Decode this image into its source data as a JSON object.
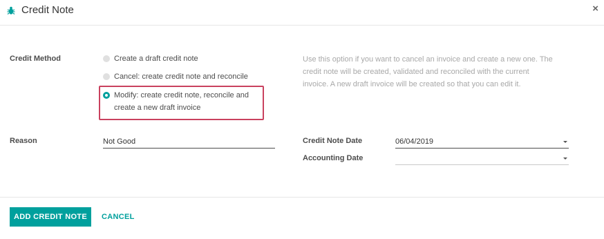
{
  "dialog": {
    "title": "Credit Note",
    "close_glyph": "×"
  },
  "credit_method": {
    "label": "Credit Method",
    "options": [
      {
        "lines": [
          "Create a draft credit note"
        ],
        "selected": false
      },
      {
        "lines": [
          "Cancel: create credit note and reconcile"
        ],
        "selected": false
      },
      {
        "lines": [
          "Modify: create credit note, reconcile and",
          "create a new draft invoice"
        ],
        "selected": true
      }
    ],
    "help_lines": [
      "Use this option if you want to cancel an invoice and create a new one. The",
      "credit note will be created, validated and reconciled with the current",
      "invoice. A new draft invoice will be created so that you can edit it."
    ]
  },
  "reason": {
    "label": "Reason",
    "value": "Not Good"
  },
  "credit_note_date": {
    "label": "Credit Note Date",
    "value": "06/04/2019"
  },
  "accounting_date": {
    "label": "Accounting Date",
    "value": ""
  },
  "footer": {
    "primary_label": "ADD CREDIT NOTE",
    "cancel_label": "CANCEL"
  },
  "colors": {
    "accent": "#00a09d",
    "highlight_border": "#c9415e"
  },
  "icons": {
    "title_icon": "bug-icon",
    "close": "close-icon",
    "dropdown": "caret-down-icon"
  }
}
